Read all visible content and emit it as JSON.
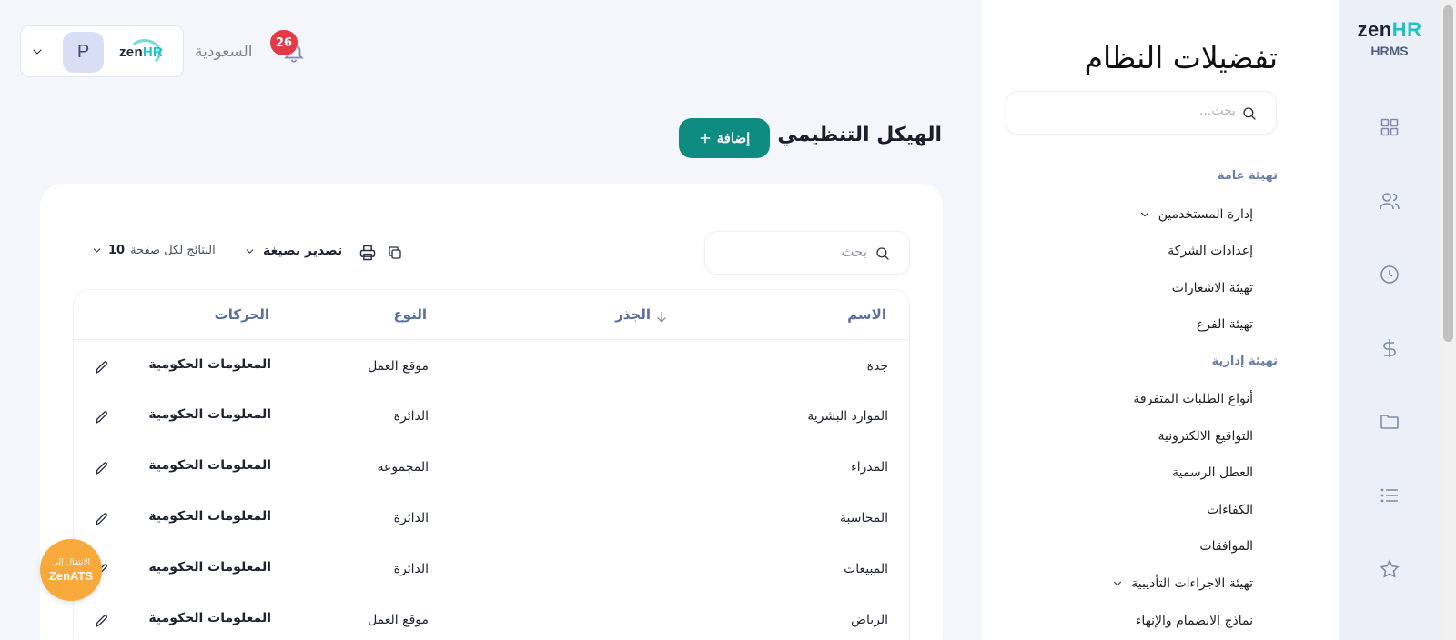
{
  "rail": {
    "logo_zen": "zen",
    "logo_hr": "HR",
    "logo_sub": "HRMS",
    "icons": [
      "grid-icon",
      "users-icon",
      "clock-icon",
      "dollar-icon",
      "folder-icon",
      "list-icon",
      "star-icon"
    ]
  },
  "settings": {
    "title": "تفضيلات النظام",
    "search_placeholder": "بحث...",
    "sections": [
      {
        "label": "تهيئة عامة",
        "items": [
          {
            "label": "إدارة المستخدمين",
            "expandable": true
          },
          {
            "label": "إعدادات الشركة",
            "expandable": false
          },
          {
            "label": "تهيئة الاشعارات",
            "expandable": false
          },
          {
            "label": "تهيئة الفرع",
            "expandable": false
          }
        ]
      },
      {
        "label": "تهيئة إدارية",
        "items": [
          {
            "label": "أنواع الطلبات المتفرقة",
            "expandable": false
          },
          {
            "label": "التواقيع الالكترونية",
            "expandable": false
          },
          {
            "label": "العطل الرسمية",
            "expandable": false
          },
          {
            "label": "الكفاءات",
            "expandable": false
          },
          {
            "label": "الموافقات",
            "expandable": false
          },
          {
            "label": "تهيئة الاجراءات التأديبية",
            "expandable": true
          },
          {
            "label": "نماذج الانضمام والإنهاء",
            "expandable": false
          }
        ]
      }
    ]
  },
  "header": {
    "avatar_initial": "P",
    "logo_zen": "zen",
    "logo_hr": "HR",
    "country": "السعودية",
    "notifications_count": "26"
  },
  "page": {
    "title": "الهيكل التنظيمي",
    "add_label": "إضافة"
  },
  "table": {
    "search_placeholder": "بحث",
    "export_label": "تصدير بصيغة",
    "per_page_label": "النتائج لكل صفحة",
    "per_page_value": "10",
    "columns": {
      "name": "الاسم",
      "root": "الجذر",
      "type": "النوع",
      "actions": "الحركات"
    },
    "rows": [
      {
        "name": "جدة",
        "root": "",
        "type": "موقع العمل",
        "action": "المعلومات الحكومية"
      },
      {
        "name": "الموارد البشرية",
        "root": "",
        "type": "الدائرة",
        "action": "المعلومات الحكومية"
      },
      {
        "name": "المدراء",
        "root": "",
        "type": "المجموعة",
        "action": "المعلومات الحكومية"
      },
      {
        "name": "المحاسبة",
        "root": "",
        "type": "الدائرة",
        "action": "المعلومات الحكومية"
      },
      {
        "name": "المبيعات",
        "root": "",
        "type": "الدائرة",
        "action": "المعلومات الحكومية"
      },
      {
        "name": "الرياض",
        "root": "",
        "type": "موقع العمل",
        "action": "المعلومات الحكومية"
      }
    ]
  },
  "ats_button": {
    "line1": "الانتقال إلى",
    "line2": "ZenATS"
  },
  "colors": {
    "primary": "#0f8c82",
    "badge": "#e53946",
    "ats": "#f7a93b",
    "accent_teal": "#1ec2c2"
  }
}
